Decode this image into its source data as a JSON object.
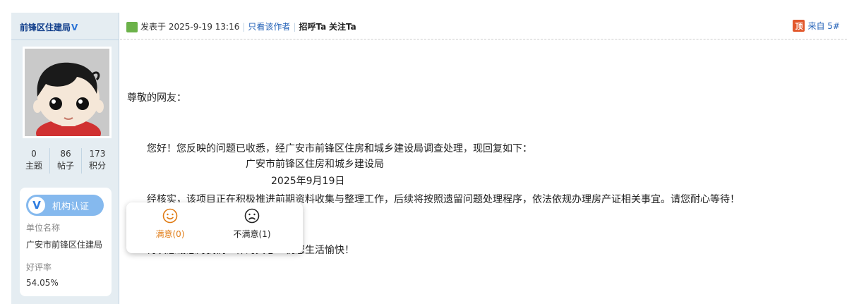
{
  "author": {
    "name": "前锋区住建局",
    "verify_mark": "V",
    "stats": [
      {
        "value": "0",
        "label": "主题"
      },
      {
        "value": "86",
        "label": "帖子"
      },
      {
        "value": "173",
        "label": "积分"
      }
    ],
    "cert": {
      "badge_icon": "V",
      "badge_label": "机构认证",
      "unit_label": "单位名称",
      "unit_value": "广安市前锋区住建局",
      "rating_label": "好评率",
      "rating_value": "54.05%"
    }
  },
  "post": {
    "posted_prefix": "发表于",
    "posted_time": "2025-9-19 13:16",
    "only_author": "只看该作者",
    "greet": "招呼Ta",
    "follow": "关注Ta",
    "floor_icon": "顶",
    "floor_text": "来自 5#",
    "lines": [
      "尊敬的网友：",
      "您好！您反映的问题已收悉，经广安市前锋区住房和城乡建设局调查处理，现回复如下：",
      "经核实，该项目正在积极推进前期资料收集与整理工作，后续将按照遗留问题处理程序，依法依规办理房产证相关事宜。请您耐心等待！",
      "再次感谢您对我们工作的关心！祝您生活愉快！"
    ],
    "signature": {
      "org": "广安市前锋区住房和城乡建设局",
      "date": "2025年9月19日"
    }
  },
  "vote": {
    "satisfied": "满意(0)",
    "unsatisfied": "不满意(1)"
  },
  "colors": {
    "accent": "#2563b8",
    "sidebar_bg": "#e5edf2",
    "satisfied": "#e07b14",
    "badge_bg": "#85b9ee"
  },
  "icons": {
    "online": "online-user-icon",
    "floor": "top-badge-icon",
    "satisfied": "smile-face-icon",
    "unsatisfied": "frown-face-icon"
  }
}
